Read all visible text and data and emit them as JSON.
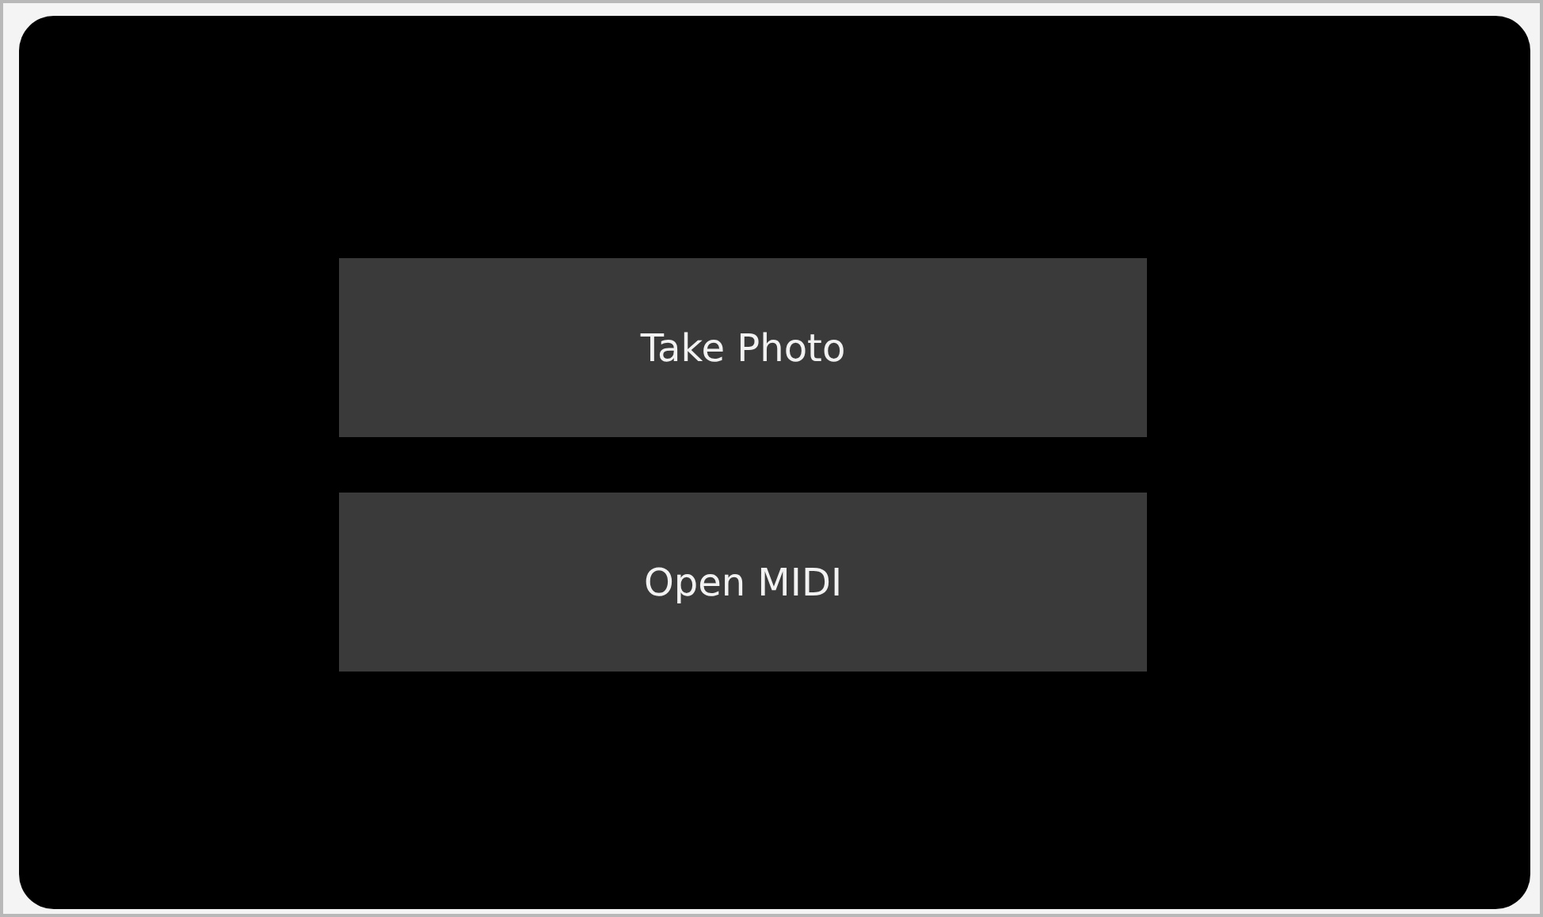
{
  "buttons": [
    {
      "label": "Take Photo"
    },
    {
      "label": "Open MIDI"
    }
  ]
}
